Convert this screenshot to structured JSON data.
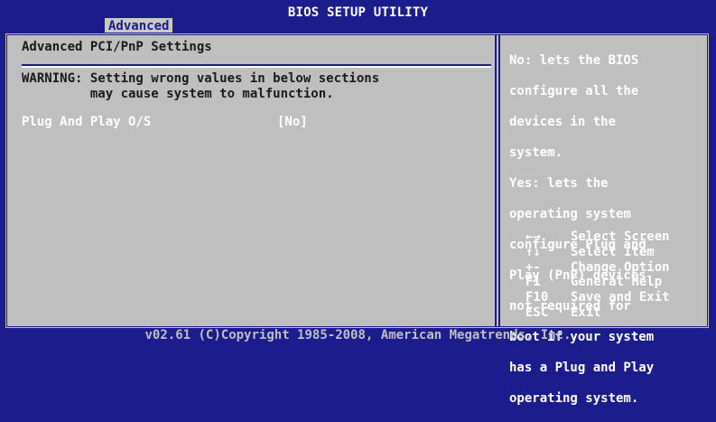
{
  "header": {
    "title": "BIOS SETUP UTILITY",
    "active_tab": "Advanced"
  },
  "main": {
    "section_title": "Advanced PCI/PnP Settings",
    "warning_line1": "WARNING: Setting wrong values in below sections",
    "warning_line2": "         may cause system to malfunction.",
    "options": [
      {
        "label": "Plug And Play O/S",
        "value": "[No]"
      }
    ]
  },
  "help": {
    "lines": [
      "No: lets the BIOS",
      "configure all the",
      "devices in the",
      "system.",
      "Yes: lets the",
      "operating system",
      "configure Plug and",
      "Play (PnP) devices",
      "not required for",
      "boot if your system",
      "has a Plug and Play",
      "operating system."
    ]
  },
  "keys": [
    {
      "key": "←→",
      "icon": "left-right-arrows-icon",
      "desc": "Select Screen"
    },
    {
      "key": "↑↓",
      "icon": "up-down-arrows-icon",
      "desc": "Select Item"
    },
    {
      "key": "+-",
      "desc": "Change Option"
    },
    {
      "key": "F1",
      "desc": "General Help"
    },
    {
      "key": "F10",
      "desc": "Save and Exit"
    },
    {
      "key": "ESC",
      "desc": "Exit"
    }
  ],
  "footer": {
    "copyright": "v02.61 (C)Copyright 1985-2008, American Megatrends, Inc."
  },
  "colors": {
    "background": "#1b1d8c",
    "panel": "#bfbfbf",
    "highlight_text": "#ffffff"
  }
}
